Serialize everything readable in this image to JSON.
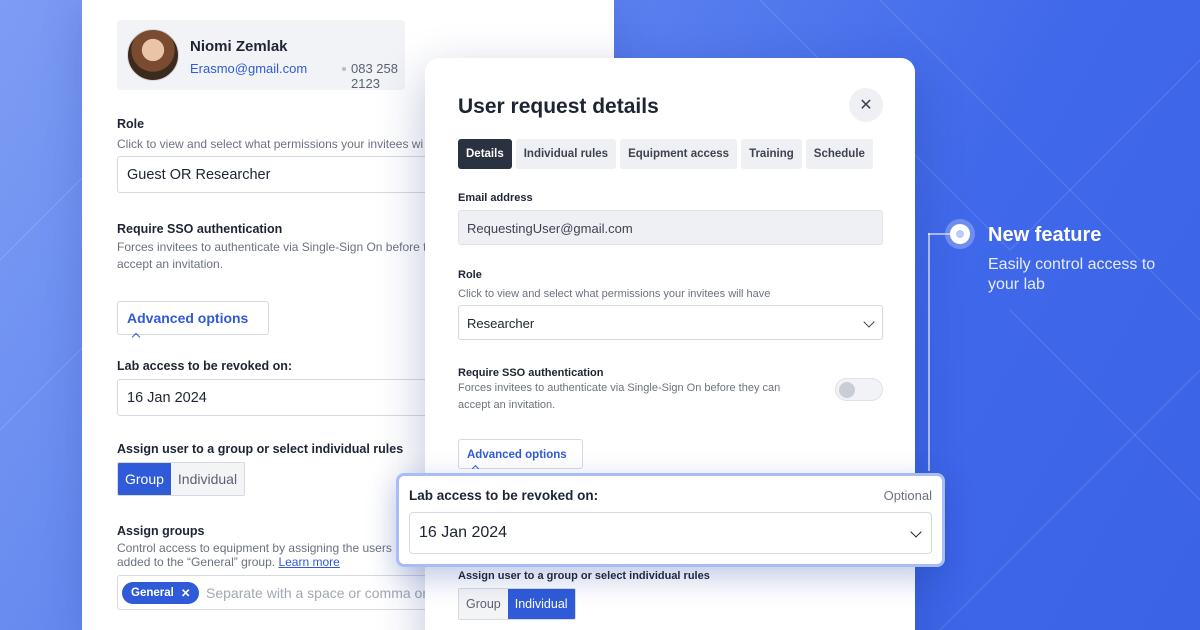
{
  "colors": {
    "accent": "#2f5bd8",
    "background": "#3f68ea",
    "highlight_border": "#a9bdf5"
  },
  "back_panel": {
    "user": {
      "name": "Niomi Zemlak",
      "email": "Erasmo@gmail.com",
      "phone": "083 258 2123"
    },
    "role": {
      "label": "Role",
      "help": "Click to view and select what permissions your invitees wi",
      "value": "Guest OR Researcher"
    },
    "sso": {
      "label": "Require SSO authentication",
      "help": "Forces invitees to authenticate via Single-Sign On before t accept an invitation."
    },
    "advanced_options": "Advanced options",
    "revoke": {
      "label": "Lab access to be revoked on:",
      "value": "16 Jan 2024"
    },
    "assign": {
      "label": "Assign user to a group or select individual rules",
      "group": "Group",
      "individual": "Individual"
    },
    "groups": {
      "label": "Assign groups",
      "help": "Control access to equipment by assigning the users",
      "help2": "added to the “General” group.",
      "learn_more": "Learn more",
      "chip": "General",
      "placeholder": "Separate with a space or comma or"
    }
  },
  "modal": {
    "title": "User request details",
    "tabs": [
      "Details",
      "Individual rules",
      "Equipment access",
      "Training",
      "Schedule"
    ],
    "email": {
      "label": "Email address",
      "value": "RequestingUser@gmail.com"
    },
    "role": {
      "label": "Role",
      "help": "Click to view and select what permissions your invitees will have",
      "value": "Researcher"
    },
    "sso": {
      "label": "Require SSO authentication",
      "help": "Forces invitees to authenticate via Single-Sign On before they can",
      "help2": "accept an invitation.",
      "enabled": false
    },
    "advanced_options": "Advanced options",
    "assign": {
      "label": "Assign user to a group or select individual rules",
      "group": "Group",
      "individual": "Individual"
    }
  },
  "highlight": {
    "label": "Lab access to be revoked on:",
    "optional": "Optional",
    "value": "16 Jan 2024"
  },
  "feature": {
    "title": "New feature",
    "subtitle": "Easily control access to your lab"
  }
}
